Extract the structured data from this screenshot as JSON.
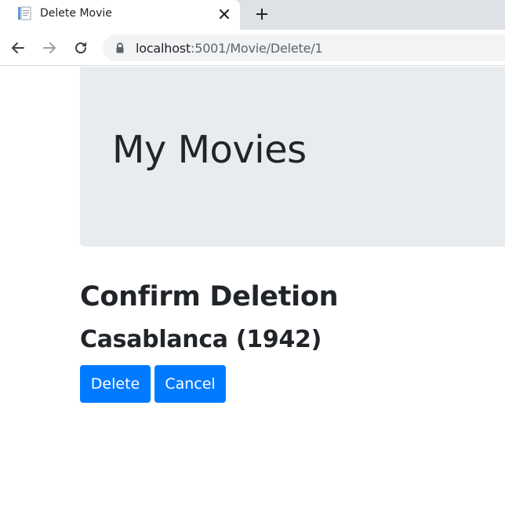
{
  "browser": {
    "tab": {
      "title": "Delete Movie",
      "favicon": "document-icon"
    },
    "new_tab_icon": "plus-icon",
    "address_bar": {
      "host": "localhost",
      "path": ":5001/Movie/Delete/1",
      "secure_icon": "lock-icon"
    },
    "nav_icons": [
      "back-arrow-icon",
      "forward-arrow-icon",
      "reload-icon"
    ]
  },
  "page": {
    "site_title": "My Movies",
    "heading": "Confirm Deletion",
    "movie": "Casablanca (1942)",
    "buttons": {
      "delete_label": "Delete",
      "cancel_label": "Cancel"
    }
  },
  "colors": {
    "primary": "#007bff",
    "jumbotron_bg": "#e9ecef",
    "text": "#212529",
    "tabstrip_bg": "#dee1e6"
  }
}
